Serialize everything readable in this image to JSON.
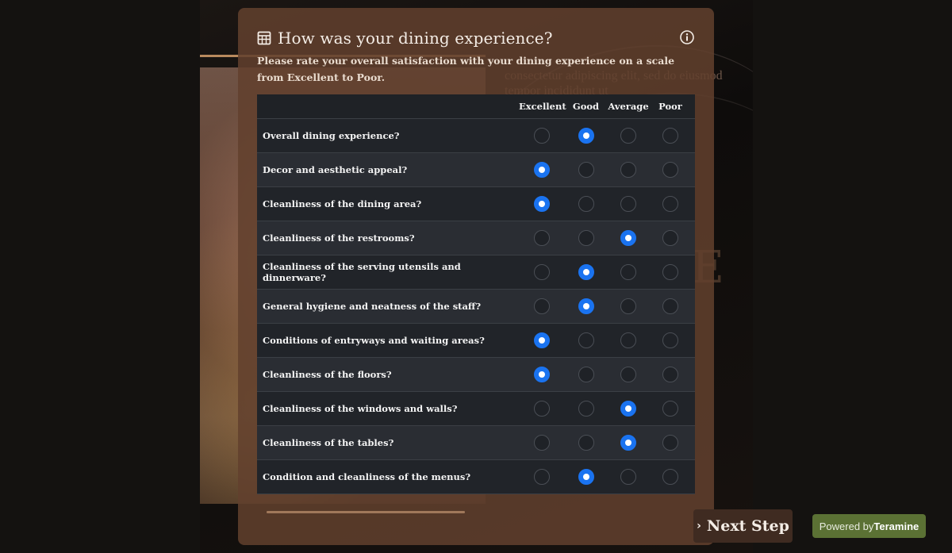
{
  "background": {
    "ghost_text": "consectetur adipiscing elit, sed do eiusmod tempor incididunt ut",
    "big_letter": "E"
  },
  "survey": {
    "title": "How was your dining experience?",
    "title_icon": "table-icon",
    "info_icon": "info-icon",
    "description": "Please rate your overall satisfaction with your dining experience on a scale from Excellent to Poor.",
    "columns": [
      "Excellent",
      "Good",
      "Average",
      "Poor"
    ],
    "rows": [
      {
        "label": "Overall dining experience?",
        "selected": "Good"
      },
      {
        "label": "Decor and aesthetic appeal?",
        "selected": "Excellent"
      },
      {
        "label": "Cleanliness of the dining area?",
        "selected": "Excellent"
      },
      {
        "label": "Cleanliness of the restrooms?",
        "selected": "Average"
      },
      {
        "label": "Cleanliness of the serving utensils and dinnerware?",
        "selected": "Good"
      },
      {
        "label": "General hygiene and neatness of the staff?",
        "selected": "Good"
      },
      {
        "label": "Conditions of entryways and waiting areas?",
        "selected": "Excellent"
      },
      {
        "label": "Cleanliness of the floors?",
        "selected": "Excellent"
      },
      {
        "label": "Cleanliness of the windows and walls?",
        "selected": "Average"
      },
      {
        "label": "Cleanliness of the tables?",
        "selected": "Average"
      },
      {
        "label": "Condition and cleanliness of the menus?",
        "selected": "Good"
      }
    ]
  },
  "footer": {
    "progress_percent": 100,
    "next_label": "Next Step",
    "next_icon": "chevron-right-icon",
    "powered_prefix": "Powered by",
    "powered_brand": "Teramine"
  },
  "colors": {
    "accent": "#1a73f0",
    "card": "#62402d",
    "badge": "#5b7134"
  }
}
